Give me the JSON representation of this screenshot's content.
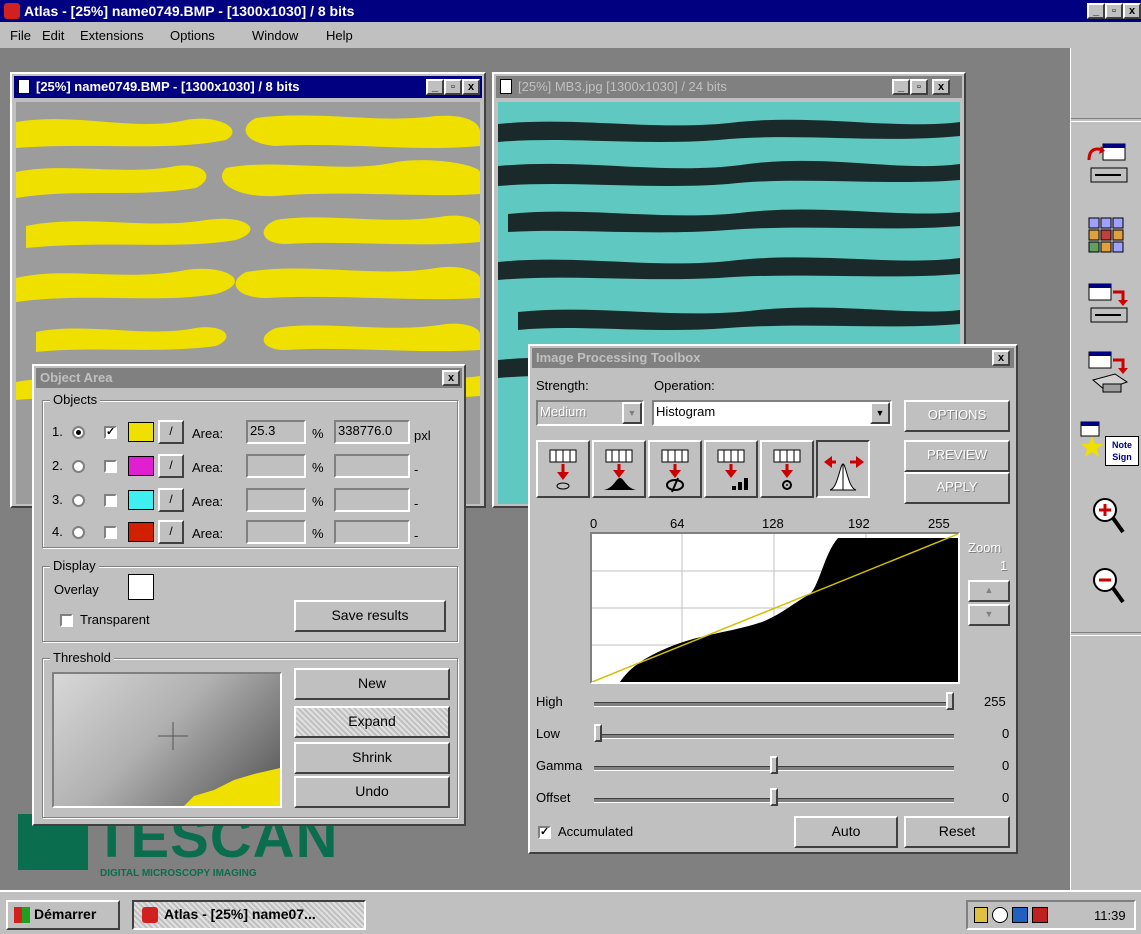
{
  "app": {
    "title": "Atlas - [25%] name0749.BMP - [1300x1030] / 8 bits",
    "min": "_",
    "max": "▫",
    "close": "x"
  },
  "menu": [
    "File",
    "Edit",
    "Extensions",
    "Options",
    "Window",
    "Help"
  ],
  "win1": {
    "title": "[25%] name0749.BMP - [1300x1030] / 8 bits"
  },
  "win2": {
    "title": "[25%] MB3.jpg   [1300x1030] / 24 bits"
  },
  "object_area": {
    "title": "Object Area",
    "objects_label": "Objects",
    "rows": [
      {
        "index": "1.",
        "color": "#f0e000",
        "area_label": "Area:",
        "percent": "25.3",
        "percent_unit": "%",
        "pixels": "338776.0",
        "pixel_unit": "pxl"
      },
      {
        "index": "2.",
        "color": "#e020d0",
        "area_label": "Area:",
        "percent": "",
        "percent_unit": "%",
        "pixels": "",
        "pixel_unit": "-"
      },
      {
        "index": "3.",
        "color": "#40f0f0",
        "area_label": "Area:",
        "percent": "",
        "percent_unit": "%",
        "pixels": "",
        "pixel_unit": "-"
      },
      {
        "index": "4.",
        "color": "#d02000",
        "area_label": "Area:",
        "percent": "",
        "percent_unit": "%",
        "pixels": "",
        "pixel_unit": "-"
      }
    ],
    "display_label": "Display",
    "overlay_label": "Overlay",
    "transparent_label": "Transparent",
    "save_results": "Save results",
    "threshold_label": "Threshold",
    "new": "New",
    "expand": "Expand",
    "shrink": "Shrink",
    "undo": "Undo"
  },
  "toolbox": {
    "title": "Image Processing Toolbox",
    "strength_label": "Strength:",
    "strength_value": "Medium",
    "operation_label": "Operation:",
    "operation_value": "Histogram",
    "options": "OPTIONS",
    "preview": "PREVIEW",
    "apply": "APPLY",
    "axis_ticks": [
      "0",
      "64",
      "128",
      "192",
      "255"
    ],
    "zoom_label": "Zoom",
    "zoom_value": "1",
    "sliders": [
      {
        "label": "High",
        "value": "255",
        "level": 1.0
      },
      {
        "label": "Low",
        "value": "0",
        "level": 0.0
      },
      {
        "label": "Gamma",
        "value": "0",
        "level": 0.5
      },
      {
        "label": "Offset",
        "value": "0",
        "level": 0.5
      }
    ],
    "accumulated_label": "Accumulated",
    "auto": "Auto",
    "reset": "Reset"
  },
  "logo": {
    "text": "TESCAN",
    "tagline": "DIGITAL MICROSCOPY IMAGING"
  },
  "right_toolbar": {
    "note_sign": "Note Sign"
  },
  "taskbar": {
    "start": "Démarrer",
    "task": "Atlas - [25%] name07...",
    "clock": "11:39"
  },
  "colors": {
    "title_active": "#000080",
    "face": "#c0c0c0",
    "overlay_yellow": "#f0e000",
    "cyan_image": "#5fc8c0"
  }
}
